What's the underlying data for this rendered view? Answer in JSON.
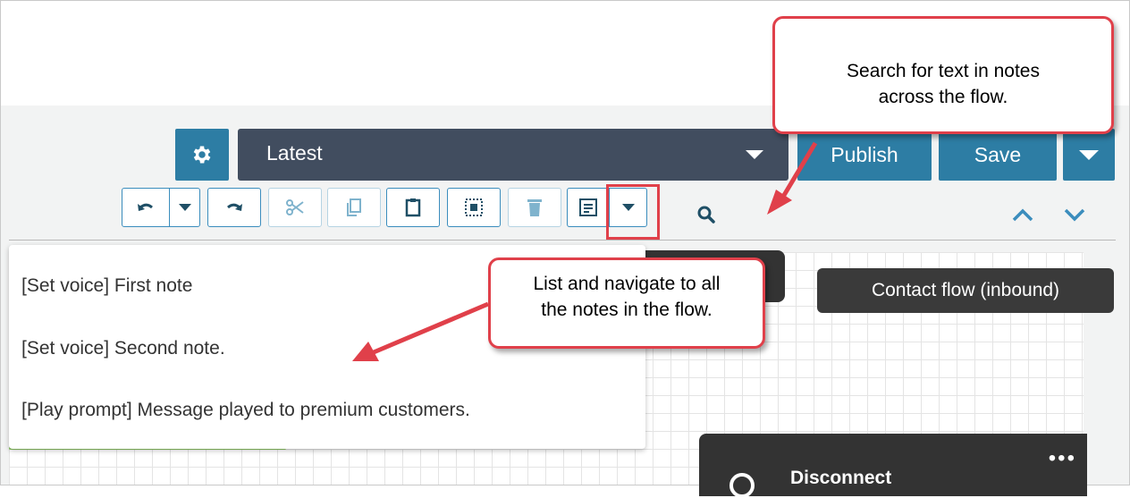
{
  "toolbar": {
    "settings_icon": "gear-icon",
    "version_value": "Latest",
    "publish_label": "Publish",
    "save_label": "Save",
    "icons": [
      "undo-icon",
      "chevron-down-icon",
      "redo-icon",
      "cut-icon",
      "copy-icon",
      "paste-icon",
      "select-all-icon",
      "delete-icon",
      "notes-icon",
      "chevron-down-icon",
      "search-icon",
      "chevron-up-icon",
      "chevron-down-icon"
    ]
  },
  "notes_list": {
    "items": [
      "[Set voice] First note",
      "[Set voice] Second note.",
      "[Play prompt] Message played to premium customers."
    ]
  },
  "canvas": {
    "flow_type_label": "Contact flow (inbound)",
    "block_title": "Disconnect"
  },
  "callouts": {
    "search": {
      "line1": "Search for text in notes",
      "line2": "across the flow."
    },
    "notes": {
      "line1": "List and navigate to all",
      "line2": "the notes in the flow."
    }
  },
  "colors": {
    "accent": "#2d7da4",
    "select_bg": "#414d5f",
    "callout_border": "#e0404a",
    "arrow": "#e0404a"
  }
}
